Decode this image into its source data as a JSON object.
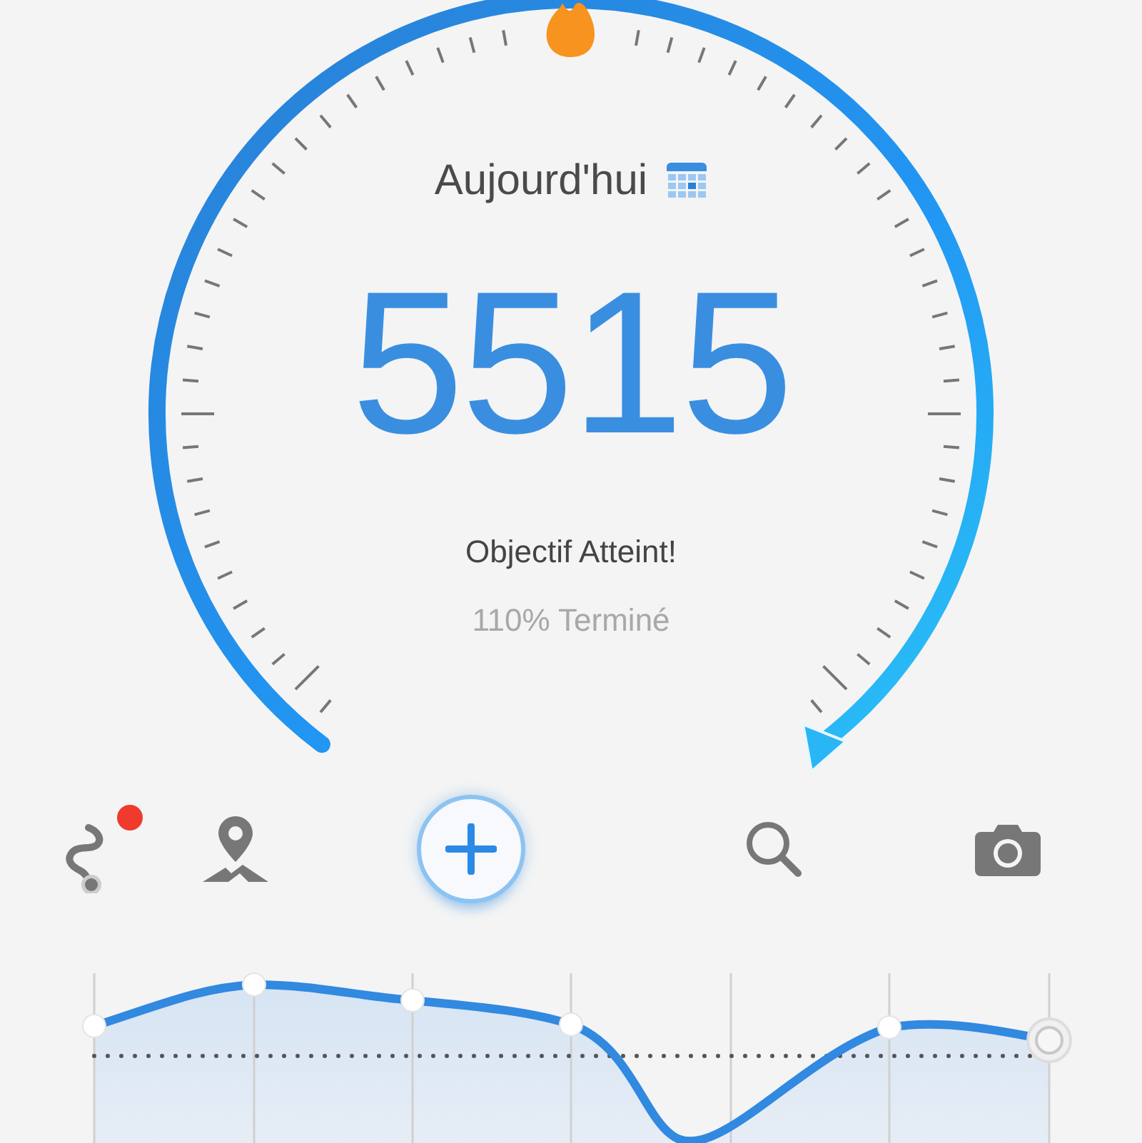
{
  "gauge": {
    "period_label": "Aujourd'hui",
    "steps": "5515",
    "status": "Objectif Atteint!",
    "completion": "110% Terminé"
  },
  "toolbar": [
    {
      "kind": "route",
      "badge": true
    },
    {
      "kind": "map",
      "badge": false
    },
    {
      "kind": "add",
      "badge": false
    },
    {
      "kind": "search",
      "badge": false
    },
    {
      "kind": "camera",
      "badge": false
    }
  ],
  "trend_chart": {
    "kind": "line"
  }
}
